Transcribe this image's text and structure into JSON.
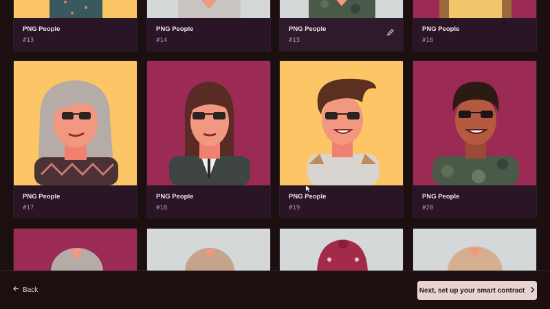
{
  "colors": {
    "yellow": "#fcc566",
    "magenta": "#9b2a55",
    "gray": "#d4d8d9",
    "card_footer": "#2a1526",
    "page_bg": "#1c0f10",
    "primary_button": "#e7d4d0"
  },
  "grid": {
    "rows": [
      {
        "cards": [
          {
            "collection": "PNG People",
            "number": "#13",
            "bg": "yellow",
            "shirt": "#385a5f"
          },
          {
            "collection": "PNG People",
            "number": "#14",
            "bg": "gray",
            "shirt": "#c9c6c1"
          },
          {
            "collection": "PNG People",
            "number": "#15",
            "bg": "gray",
            "shirt": "#4a5a48",
            "edit_icon": "pencil-icon"
          },
          {
            "collection": "PNG People",
            "number": "#16",
            "bg": "magenta",
            "shirt": "#f1c56c"
          }
        ]
      },
      {
        "cards": [
          {
            "collection": "PNG People",
            "number": "#17",
            "bg": "yellow",
            "hair": "#b5aca7",
            "shirt": "#4a3236"
          },
          {
            "collection": "PNG People",
            "number": "#18",
            "bg": "magenta",
            "hair": "#5a2a24",
            "shirt": "#3f4543"
          },
          {
            "collection": "PNG People",
            "number": "#19",
            "bg": "yellow",
            "hair": "#5b3020",
            "shirt": "#d8d4cf"
          },
          {
            "collection": "PNG People",
            "number": "#20",
            "bg": "magenta",
            "hair": "#2d1a14",
            "shirt": "#4b5a48"
          }
        ]
      },
      {
        "cards": [
          {
            "bg": "magenta"
          },
          {
            "bg": "gray"
          },
          {
            "bg": "gray"
          },
          {
            "bg": "gray"
          }
        ]
      }
    ]
  },
  "footer": {
    "back_label": "Back",
    "next_label": "Next, set up your smart contract"
  }
}
